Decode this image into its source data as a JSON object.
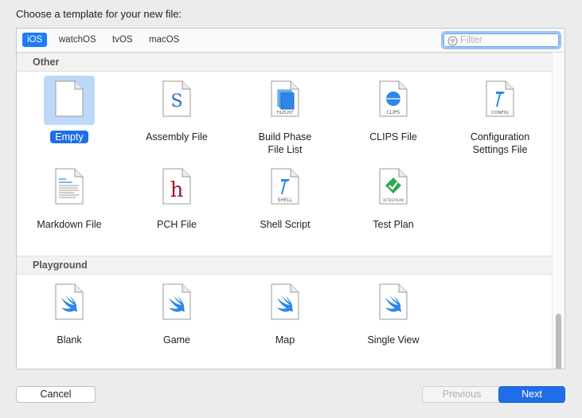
{
  "dialog": {
    "title": "Choose a template for your new file:"
  },
  "platform_tabs": [
    {
      "label": "iOS",
      "selected": true
    },
    {
      "label": "watchOS",
      "selected": false
    },
    {
      "label": "tvOS",
      "selected": false
    },
    {
      "label": "macOS",
      "selected": false
    }
  ],
  "filter": {
    "placeholder": "Filter",
    "value": ""
  },
  "sections": [
    {
      "header": "Other",
      "items": [
        {
          "label": "Empty",
          "icon": "blank-document-icon",
          "selected": true
        },
        {
          "label": "Assembly File",
          "icon": "assembly-file-icon",
          "badge": "S"
        },
        {
          "label": "Build Phase\nFile List",
          "icon": "filelist-icon",
          "badge": "FILELIST"
        },
        {
          "label": "CLIPS File",
          "icon": "clips-file-icon",
          "badge": "CLIPS"
        },
        {
          "label": "Configuration\nSettings File",
          "icon": "config-file-icon",
          "badge": "CONFIG"
        },
        {
          "label": "Markdown File",
          "icon": "markdown-file-icon"
        },
        {
          "label": "PCH File",
          "icon": "pch-file-icon",
          "badge": "h"
        },
        {
          "label": "Shell Script",
          "icon": "shell-script-icon",
          "badge": "SHELL"
        },
        {
          "label": "Test Plan",
          "icon": "test-plan-icon",
          "badge": "XCTESTPLAN"
        }
      ]
    },
    {
      "header": "Playground",
      "items": [
        {
          "label": "Blank",
          "icon": "swift-playground-icon"
        },
        {
          "label": "Game",
          "icon": "swift-playground-icon"
        },
        {
          "label": "Map",
          "icon": "swift-playground-icon"
        },
        {
          "label": "Single View",
          "icon": "swift-playground-icon"
        }
      ]
    }
  ],
  "buttons": {
    "cancel": "Cancel",
    "previous": "Previous",
    "next": "Next"
  },
  "colors": {
    "accent": "#1f6ee8",
    "selection_bg": "#bdd8f8",
    "swift_blue": "#2d87e8",
    "test_green": "#2fa84f",
    "pch_red": "#a3182b"
  }
}
